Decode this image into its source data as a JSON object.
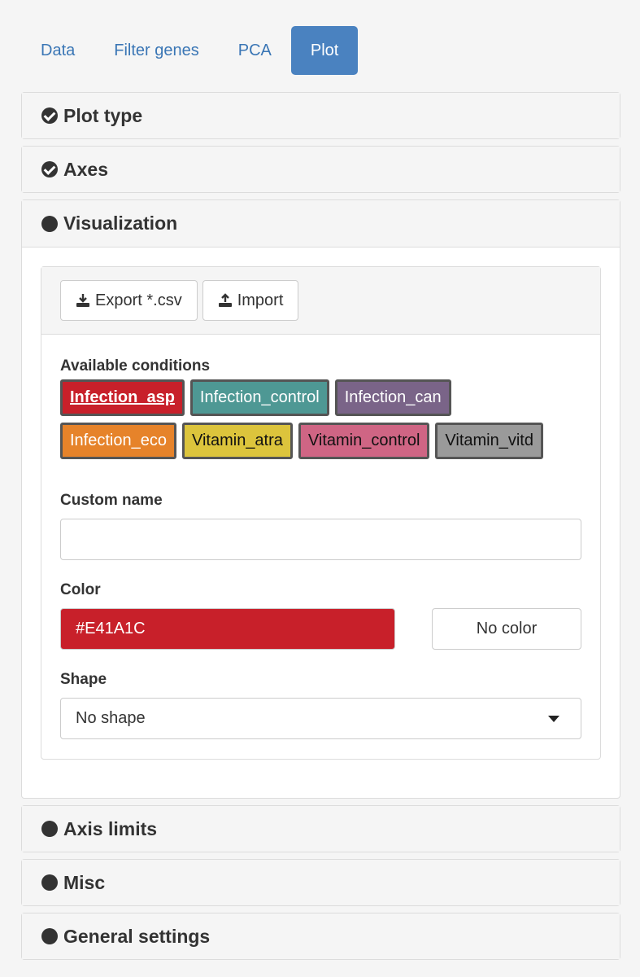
{
  "tabs": [
    {
      "label": "Data",
      "active": false
    },
    {
      "label": "Filter genes",
      "active": false
    },
    {
      "label": "PCA",
      "active": false
    },
    {
      "label": "Plot",
      "active": true
    }
  ],
  "sections": {
    "plot_type": {
      "title": "Plot type",
      "icon": "check-circle-icon"
    },
    "axes": {
      "title": "Axes",
      "icon": "check-circle-icon"
    },
    "visualization": {
      "title": "Visualization",
      "icon": "dot-icon"
    },
    "axis_limits": {
      "title": "Axis limits",
      "icon": "dot-icon"
    },
    "misc": {
      "title": "Misc",
      "icon": "dot-icon"
    },
    "general_settings": {
      "title": "General settings",
      "icon": "dot-icon"
    }
  },
  "visualization": {
    "export_label": "Export *.csv",
    "import_label": "Import",
    "conditions_label": "Available conditions",
    "conditions": [
      {
        "label": "Infection_asp",
        "color": "#c8202a",
        "text_color": "#ffffff",
        "selected": true
      },
      {
        "label": "Infection_control",
        "color": "#4e9894",
        "text_color": "#ffffff",
        "selected": false
      },
      {
        "label": "Infection_can",
        "color": "#7a6488",
        "text_color": "#ffffff",
        "selected": false
      },
      {
        "label": "Infection_eco",
        "color": "#e6832a",
        "text_color": "#ffffff",
        "selected": false
      },
      {
        "label": "Vitamin_atra",
        "color": "#dcc43c",
        "text_color": "#111111",
        "selected": false
      },
      {
        "label": "Vitamin_control",
        "color": "#cf6584",
        "text_color": "#111111",
        "selected": false
      },
      {
        "label": "Vitamin_vitd",
        "color": "#9a9a9a",
        "text_color": "#111111",
        "selected": false
      }
    ],
    "custom_name_label": "Custom name",
    "custom_name_value": "",
    "color_label": "Color",
    "color_value": "#E41A1C",
    "color_swatch": "#c8202a",
    "no_color_label": "No color",
    "shape_label": "Shape",
    "shape_value": "No shape"
  }
}
